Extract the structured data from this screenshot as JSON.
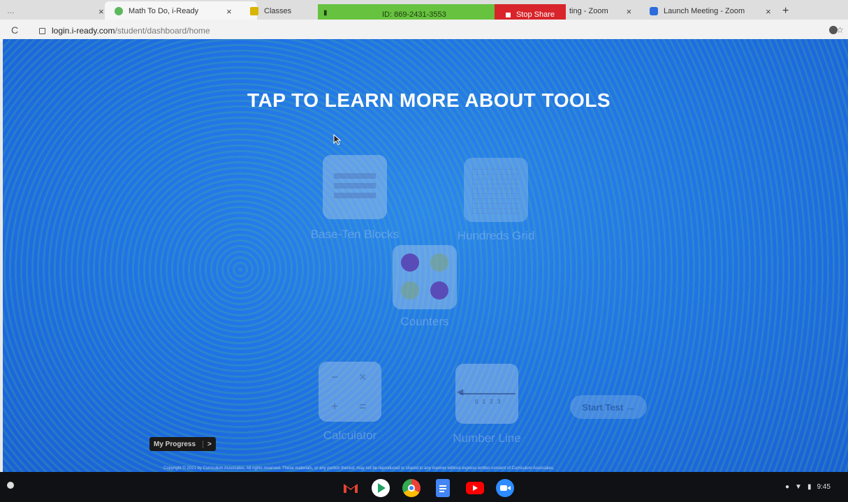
{
  "browser": {
    "tabs": [
      {
        "label": "Math To Do, i-Ready",
        "close": "×",
        "color": "#5cb85c"
      },
      {
        "label": "Classes",
        "color": "#d9b400"
      },
      {
        "label": "ting - Zoom",
        "close": "×"
      },
      {
        "label": "Launch Meeting - Zoom",
        "close": "×",
        "color": "#2d6cdf"
      }
    ],
    "new_tab": "+",
    "address_domain": "login.i-ready.com",
    "address_path": "/student/dashboard/home"
  },
  "zoom_bar": {
    "id_text": "ID: 869-2431-3553",
    "stop_share": "Stop Share"
  },
  "page": {
    "heading": "TAP TO LEARN MORE ABOUT TOOLS",
    "tools": {
      "base_ten": "Base-Ten Blocks",
      "grid": "Hundreds Grid",
      "counters": "Counters",
      "calculator": "Calculator",
      "number_line": "Number Line"
    },
    "number_line_ticks": "0 1 2 3",
    "calc_symbols": [
      "−",
      "×",
      "+",
      "="
    ],
    "start_test": "Start Test →",
    "my_progress": "My Progress",
    "my_progress_chevron": ">",
    "copyright": "Copyright © 2021 by Curriculum Associates. All rights reserved. These materials, or any portion thereof, may not be reproduced or shared in any manner without express written consent of Curriculum Associates."
  },
  "shelf": {
    "time": "9:45",
    "apps": [
      "gmail-icon",
      "play-store-icon",
      "chrome-icon",
      "docs-icon",
      "youtube-icon",
      "zoom-icon"
    ]
  },
  "colors": {
    "page_blue": "#1f6fe4",
    "zoom_green": "#67c23f",
    "stop_red": "#d8242a"
  }
}
